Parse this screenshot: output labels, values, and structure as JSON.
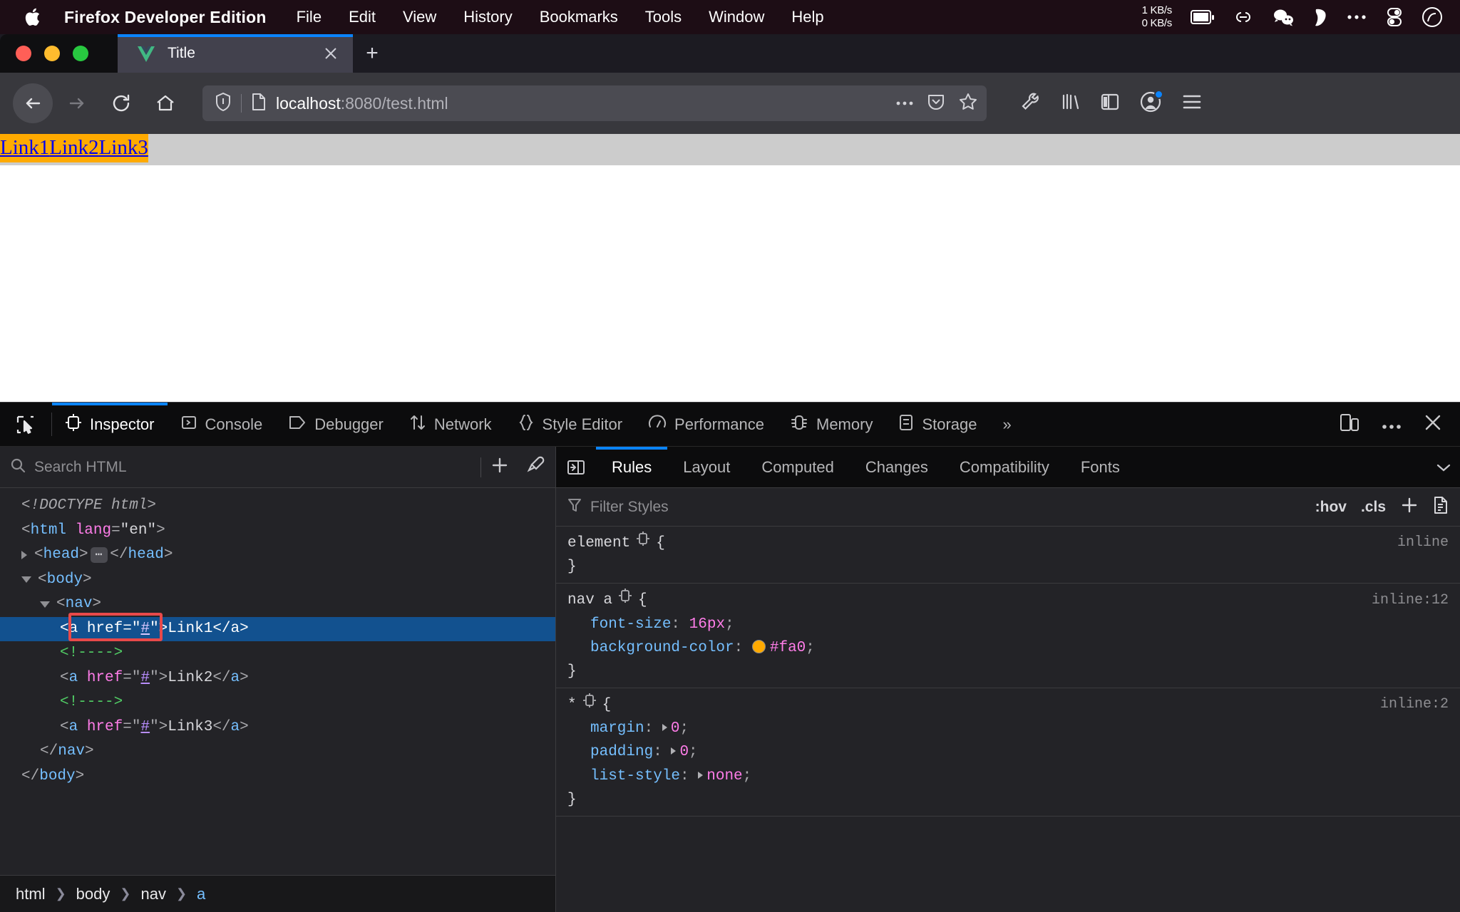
{
  "menubar": {
    "apple_icon": "apple-logo-icon",
    "app_name": "Firefox Developer Edition",
    "items": [
      "File",
      "Edit",
      "View",
      "History",
      "Bookmarks",
      "Tools",
      "Window",
      "Help"
    ],
    "network_speed": "1 KB/s\n0 KB/s",
    "tray_icons": [
      "battery-icon",
      "link-icon",
      "wechat-icon",
      "evernote-icon",
      "ellipsis-icon",
      "toggle-icon",
      "clock-icon"
    ]
  },
  "browser": {
    "tab": {
      "title": "Title",
      "favicon": "vue-logo-icon",
      "close": "close-icon"
    },
    "new_tab_label": "+",
    "nav": {
      "back": "back-arrow-icon",
      "forward": "forward-arrow-icon",
      "reload": "reload-icon",
      "home": "home-icon"
    },
    "url": {
      "host": "localhost",
      "rest": ":8080/test.html",
      "shield": "shield-icon",
      "page": "page-icon"
    },
    "url_actions": [
      "ellipsis-icon",
      "pocket-icon",
      "star-icon"
    ],
    "toolbar_right": [
      "wrench-icon",
      "library-icon",
      "sidebar-icon",
      "account-icon",
      "hamburger-menu-icon"
    ]
  },
  "page": {
    "links": [
      "Link1",
      "Link2",
      "Link3"
    ],
    "link_bg": "#ffaa00",
    "link_color": "#0000ee",
    "highlight_bg": "#cccccc"
  },
  "devtools": {
    "picker_icon": "element-picker-icon",
    "tabs": [
      {
        "label": "Inspector",
        "icon": "inspector-icon",
        "active": true
      },
      {
        "label": "Console",
        "icon": "console-icon",
        "active": false
      },
      {
        "label": "Debugger",
        "icon": "debugger-icon",
        "active": false
      },
      {
        "label": "Network",
        "icon": "network-icon",
        "active": false
      },
      {
        "label": "Style Editor",
        "icon": "style-editor-icon",
        "active": false
      },
      {
        "label": "Performance",
        "icon": "performance-icon",
        "active": false
      },
      {
        "label": "Memory",
        "icon": "memory-icon",
        "active": false
      },
      {
        "label": "Storage",
        "icon": "storage-icon",
        "active": false
      }
    ],
    "overflow_label": "»",
    "right_controls": [
      "responsive-design-mode-icon",
      "devtools-options-icon",
      "close-devtools-icon"
    ],
    "markup": {
      "search_placeholder": "Search HTML",
      "search_icon": "search-icon",
      "add_node_icon": "add-node-icon",
      "eyedropper_icon": "eyedropper-icon",
      "tree": {
        "doctype": "<!DOCTYPE html>",
        "html_open": "<html lang=\"en\">",
        "html_tag": "html",
        "html_attr": "lang",
        "html_attr_val": "\"en\"",
        "head_line": "<head>…</head>",
        "head_tag": "head",
        "body_tag": "body",
        "nav_tag": "nav",
        "a_tag": "a",
        "href_attr": "href",
        "href_val": "#",
        "link1": "Link1",
        "link2": "Link2",
        "link3": "Link3",
        "comment": "<!---->",
        "nav_close": "</nav>",
        "body_close": "</body>"
      },
      "breadcrumb": [
        "html",
        "body",
        "nav",
        "a"
      ]
    },
    "rules": {
      "tabs": [
        {
          "label": "Rules",
          "active": true
        },
        {
          "label": "Layout",
          "active": false
        },
        {
          "label": "Computed",
          "active": false
        },
        {
          "label": "Changes",
          "active": false
        },
        {
          "label": "Compatibility",
          "active": false
        },
        {
          "label": "Fonts",
          "active": false
        }
      ],
      "expander_icon": "pane-toggle-icon",
      "overflow_icon": "chevron-down-icon",
      "filter_placeholder": "Filter Styles",
      "filter_icon": "filter-icon",
      "tools": [
        ":hov",
        ".cls",
        "+",
        "new-rule-icon"
      ],
      "blocks": [
        {
          "selector": "element",
          "origin": "inline",
          "declarations": []
        },
        {
          "selector": "nav a",
          "origin": "inline:12",
          "declarations": [
            {
              "property": "font-size",
              "value": "16px",
              "swatch": null,
              "expandable": false
            },
            {
              "property": "background-color",
              "value": "#fa0",
              "swatch": "#ffaa00",
              "expandable": false
            }
          ]
        },
        {
          "selector": "*",
          "origin": "inline:2",
          "declarations": [
            {
              "property": "margin",
              "value": "0",
              "swatch": null,
              "expandable": true
            },
            {
              "property": "padding",
              "value": "0",
              "swatch": null,
              "expandable": true
            },
            {
              "property": "list-style",
              "value": "none",
              "swatch": null,
              "expandable": true
            }
          ]
        }
      ]
    }
  }
}
